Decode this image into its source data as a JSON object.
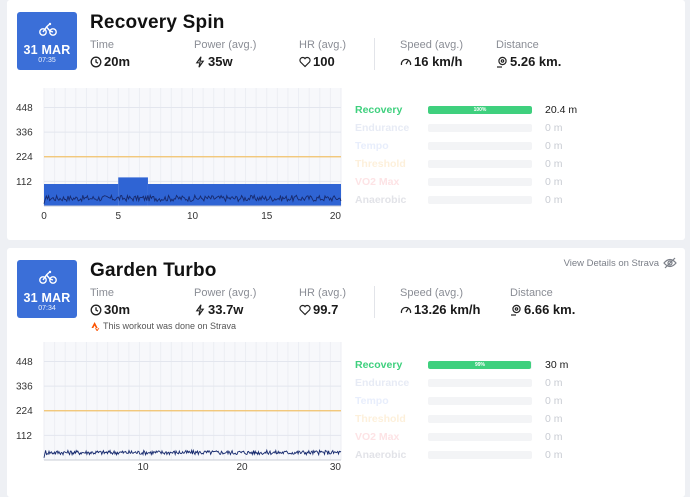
{
  "workouts": [
    {
      "title": "Recovery Spin",
      "date": {
        "day": "31 MAR",
        "time": "07:35"
      },
      "stats": {
        "time": {
          "label": "Time",
          "value": "20m"
        },
        "power": {
          "label": "Power (avg.)",
          "value": "35w"
        },
        "hr": {
          "label": "HR (avg.)",
          "value": "100"
        },
        "speed": {
          "label": "Speed (avg.)",
          "value": "16 km/h"
        },
        "distance": {
          "label": "Distance",
          "value": "5.26 km."
        }
      },
      "zones": [
        {
          "name": "Recovery",
          "color": "#3fd07e",
          "fraction": 1.0,
          "pct_label": "100%",
          "minutes": "20.4 m"
        },
        {
          "name": "Endurance",
          "color": "#e7ebf5",
          "fraction": 0,
          "pct_label": "",
          "minutes": "0 m"
        },
        {
          "name": "Tempo",
          "color": "#e8eefc",
          "fraction": 0,
          "pct_label": "",
          "minutes": "0 m"
        },
        {
          "name": "Threshold",
          "color": "#fdf0db",
          "fraction": 0,
          "pct_label": "",
          "minutes": "0 m"
        },
        {
          "name": "VO2 Max",
          "color": "#fde3e5",
          "fraction": 0,
          "pct_label": "",
          "minutes": "0 m"
        },
        {
          "name": "Anaerobic",
          "color": "#e2e3e8",
          "fraction": 0,
          "pct_label": "",
          "minutes": "0 m"
        }
      ],
      "chart_data": {
        "type": "area",
        "y_ticks": [
          "448",
          "336",
          "224",
          "112"
        ],
        "x_ticks": [
          "0",
          "5",
          "10",
          "15",
          "20"
        ],
        "xlim": [
          0,
          20
        ],
        "ylim": [
          0,
          500
        ],
        "ftp_line": 224,
        "target_blocks": [
          {
            "x_start": 0,
            "x_end": 5,
            "watts": 100
          },
          {
            "x_start": 5,
            "x_end": 7,
            "watts": 130
          },
          {
            "x_start": 7,
            "x_end": 20,
            "watts": 100
          }
        ],
        "power_mean": 35,
        "power_noise": 14,
        "samples": 260,
        "colors": {
          "block": "#2f64d4",
          "trace": "#172a6e",
          "ftp": "#f2c36b",
          "grid": "#e3e6ee",
          "bg": "#f7f8fb"
        }
      }
    },
    {
      "title": "Garden Turbo",
      "date": {
        "day": "31 MAR",
        "time": "07:34"
      },
      "strava_link": "View Details on Strava",
      "strava_note": "This workout was done on Strava",
      "stats": {
        "time": {
          "label": "Time",
          "value": "30m"
        },
        "power": {
          "label": "Power (avg.)",
          "value": "33.7w"
        },
        "hr": {
          "label": "HR (avg.)",
          "value": "99.7"
        },
        "speed": {
          "label": "Speed (avg.)",
          "value": "13.26 km/h"
        },
        "distance": {
          "label": "Distance",
          "value": "6.66 km."
        }
      },
      "zones": [
        {
          "name": "Recovery",
          "color": "#3fd07e",
          "fraction": 0.99,
          "pct_label": "99%",
          "minutes": "30 m"
        },
        {
          "name": "Endurance",
          "color": "#e7ebf5",
          "fraction": 0,
          "pct_label": "",
          "minutes": "0 m"
        },
        {
          "name": "Tempo",
          "color": "#e8eefc",
          "fraction": 0,
          "pct_label": "",
          "minutes": "0 m"
        },
        {
          "name": "Threshold",
          "color": "#fdf0db",
          "fraction": 0,
          "pct_label": "",
          "minutes": "0 m"
        },
        {
          "name": "VO2 Max",
          "color": "#fde3e5",
          "fraction": 0,
          "pct_label": "",
          "minutes": "0 m"
        },
        {
          "name": "Anaerobic",
          "color": "#e2e3e8",
          "fraction": 0,
          "pct_label": "",
          "minutes": "0 m"
        }
      ],
      "chart_data": {
        "type": "line",
        "y_ticks": [
          "448",
          "336",
          "224",
          "112"
        ],
        "x_ticks": [
          "10",
          "20",
          "30"
        ],
        "xlim": [
          0,
          30
        ],
        "ylim": [
          0,
          500
        ],
        "ftp_line": 224,
        "target_blocks": [],
        "power_mean": 34,
        "power_noise": 10,
        "samples": 360,
        "colors": {
          "block": "#2f64d4",
          "trace": "#172a6e",
          "ftp": "#f2c36b",
          "grid": "#e3e6ee",
          "bg": "#f7f8fb"
        }
      }
    }
  ]
}
